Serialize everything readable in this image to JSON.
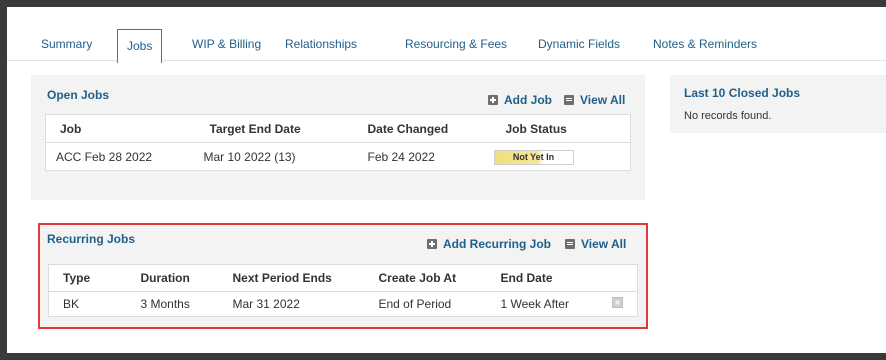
{
  "tabs": [
    {
      "label": "Summary"
    },
    {
      "label": "Jobs"
    },
    {
      "label": "WIP & Billing"
    },
    {
      "label": "Relationships"
    },
    {
      "label": "Resourcing & Fees"
    },
    {
      "label": "Dynamic Fields"
    },
    {
      "label": "Notes & Reminders"
    }
  ],
  "open_jobs": {
    "title": "Open Jobs",
    "add_label": "Add Job",
    "view_all_label": "View All",
    "columns": [
      "Job",
      "Target End Date",
      "Date Changed",
      "Job Status"
    ],
    "rows": [
      {
        "job": "ACC Feb 28 2022",
        "target_end": "Mar 10 2022 (13)",
        "date_changed": "Feb 24 2022",
        "status": "Not Yet In"
      }
    ]
  },
  "closed_jobs": {
    "title": "Last 10 Closed Jobs",
    "empty_text": "No records found."
  },
  "recurring_jobs": {
    "title": "Recurring Jobs",
    "add_label": "Add Recurring Job",
    "view_all_label": "View All",
    "columns": [
      "Type",
      "Duration",
      "Next Period Ends",
      "Create Job At",
      "End Date"
    ],
    "rows": [
      {
        "type": "BK",
        "duration": "3 Months",
        "next_period_ends": "Mar 31 2022",
        "create_job_at": "End of Period",
        "end_date": "1 Week After"
      }
    ]
  },
  "colors": {
    "link": "#1f5f8b",
    "highlight": "#e23a3a",
    "status_fill": "#f1de7a"
  }
}
